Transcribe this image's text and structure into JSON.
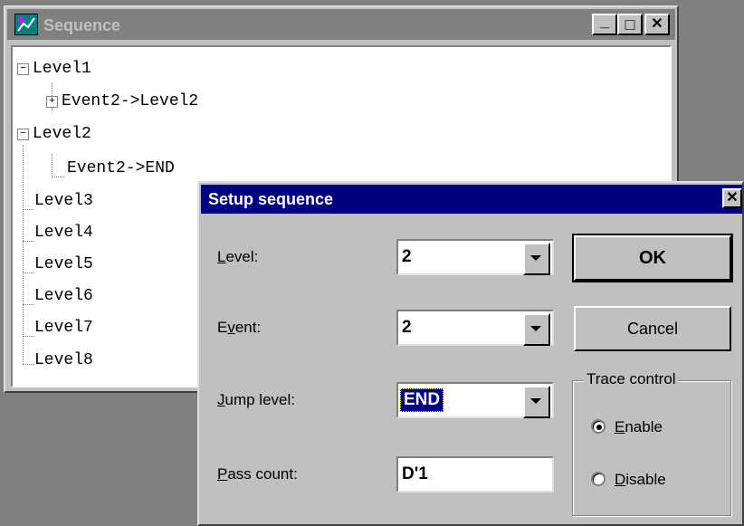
{
  "sequence_window": {
    "title": "Sequence",
    "caption_buttons": {
      "minimize": "_",
      "maximize": "□",
      "close": "✕"
    },
    "tree": [
      {
        "label": "Level1",
        "expander": "−"
      },
      {
        "label": "Event2->Level2",
        "expander": "+"
      },
      {
        "label": "Level2",
        "expander": "−"
      },
      {
        "label": "Event2->END"
      },
      {
        "label": "Level3"
      },
      {
        "label": "Level4"
      },
      {
        "label": "Level5"
      },
      {
        "label": "Level6"
      },
      {
        "label": "Level7"
      },
      {
        "label": "Level8"
      }
    ]
  },
  "dialog": {
    "title": "Setup sequence",
    "close_glyph": "✕",
    "level": {
      "label_mnemonic": "L",
      "label_rest": "evel:",
      "value": "2"
    },
    "event": {
      "label_pre": "E",
      "label_mnemonic": "v",
      "label_rest": "ent:",
      "value": "2"
    },
    "jump_level": {
      "label_mnemonic": "J",
      "label_rest": "ump level:",
      "value": "END"
    },
    "pass_count": {
      "label_mnemonic": "P",
      "label_rest": "ass count:",
      "value": "D'1"
    },
    "ok_label": "OK",
    "cancel_label": "Cancel",
    "trace_control": {
      "legend": "Trace control",
      "enable": {
        "mnemonic": "E",
        "rest": "nable",
        "checked": true
      },
      "disable": {
        "mnemonic": "D",
        "rest": "isable",
        "checked": false
      }
    }
  },
  "colors": {
    "title_active": "#000080",
    "title_inactive": "#808080",
    "face": "#c0c0c0",
    "desktop": "#808080"
  }
}
